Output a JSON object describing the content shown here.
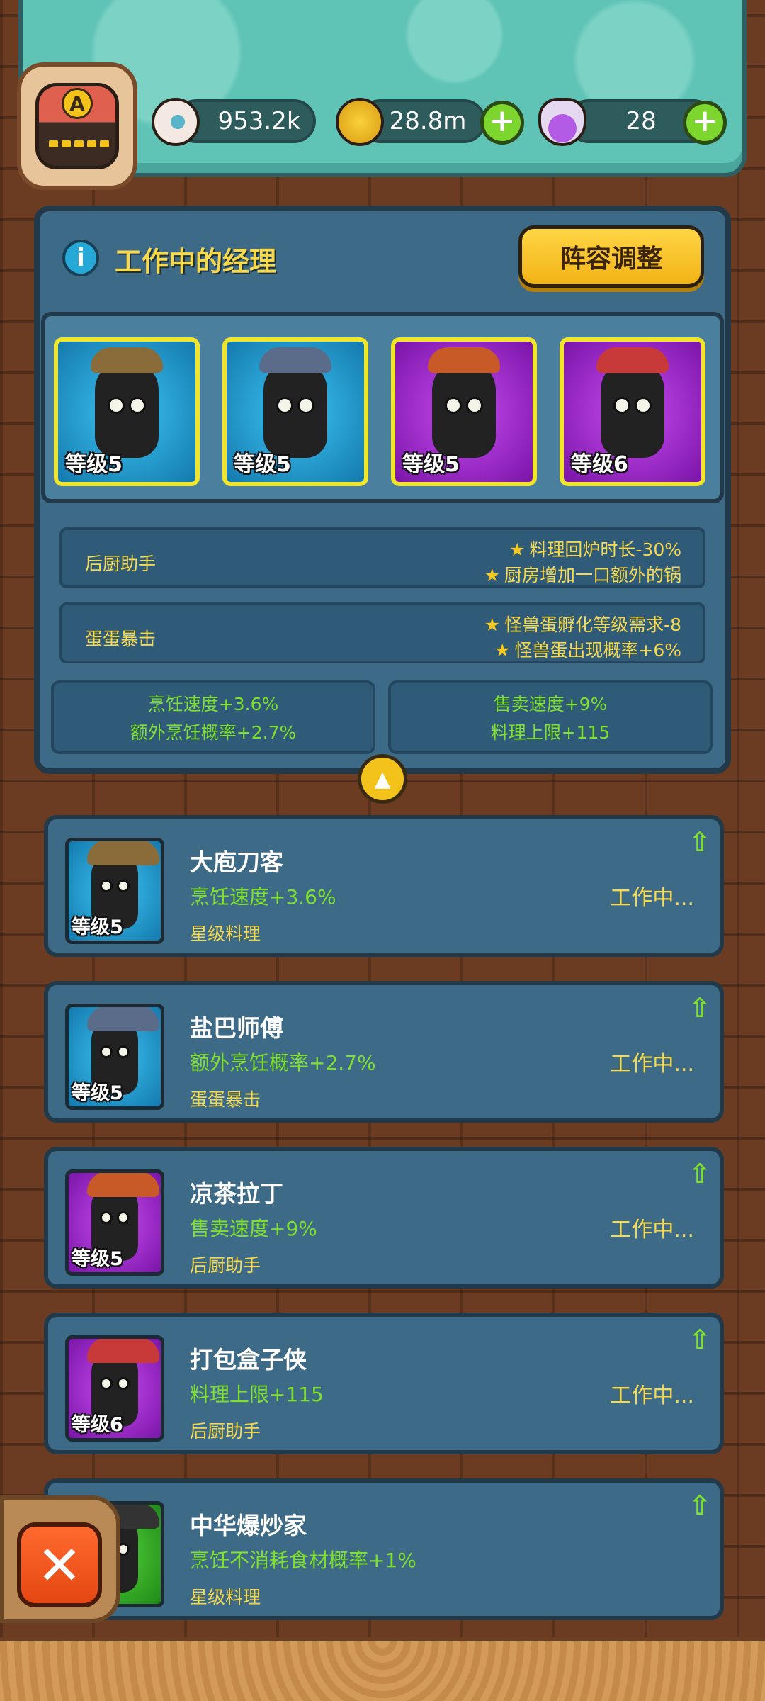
{
  "player": {
    "rank_letter": "A"
  },
  "resources": {
    "eyes": {
      "icon": "eyeball-icon",
      "value": "953.2k"
    },
    "coins": {
      "icon": "gold-coin-icon",
      "value": "28.8m",
      "plus": "+"
    },
    "potions": {
      "icon": "potion-flask-icon",
      "value": "28",
      "plus": "+"
    }
  },
  "board": {
    "info_icon": "i",
    "title": "工作中的经理",
    "lineup_button": "阵容调整",
    "managers": [
      {
        "level": "等级5",
        "rarity": "blue",
        "hat_color": "#8a6b3a"
      },
      {
        "level": "等级5",
        "rarity": "blue",
        "hat_color": "#5a6c8a"
      },
      {
        "level": "等级5",
        "rarity": "purple",
        "hat_color": "#c85a28"
      },
      {
        "level": "等级6",
        "rarity": "purple",
        "hat_color": "#c83a3a"
      }
    ],
    "bonuses": [
      {
        "name": "后厨助手",
        "lines": [
          "料理回炉时长-30%",
          "厨房增加一口额外的锅"
        ]
      },
      {
        "name": "蛋蛋暴击",
        "lines": [
          "怪兽蛋孵化等级需求-8",
          "怪兽蛋出现概率+6%"
        ]
      }
    ],
    "stats_left": [
      "烹饪速度+3.6%",
      "额外烹饪概率+2.7%"
    ],
    "stats_right": [
      "售卖速度+9%",
      "料理上限+115"
    ],
    "collapse_icon": "▲"
  },
  "list": [
    {
      "name": "大庖刀客",
      "bonus": "烹饪速度+3.6%",
      "skill": "星级料理",
      "status": "工作中...",
      "level": "等级5",
      "rarity": "blue",
      "hat_color": "#8a6b3a"
    },
    {
      "name": "盐巴师傅",
      "bonus": "额外烹饪概率+2.7%",
      "skill": "蛋蛋暴击",
      "status": "工作中...",
      "level": "等级5",
      "rarity": "blue",
      "hat_color": "#5a6c8a"
    },
    {
      "name": "凉茶拉丁",
      "bonus": "售卖速度+9%",
      "skill": "后厨助手",
      "status": "工作中...",
      "level": "等级5",
      "rarity": "purple",
      "hat_color": "#c85a28"
    },
    {
      "name": "打包盒子侠",
      "bonus": "料理上限+115",
      "skill": "后厨助手",
      "status": "工作中...",
      "level": "等级6",
      "rarity": "purple",
      "hat_color": "#c83a3a"
    },
    {
      "name": "中华爆炒家",
      "bonus": "烹饪不消耗食材概率+1%",
      "skill": "星级料理",
      "status": "",
      "level": "",
      "rarity": "green",
      "hat_color": "#333333"
    }
  ],
  "upgrade_icon": "⇧",
  "close_icon": "✕",
  "colors": {
    "accent_yellow": "#f7d94d",
    "bonus_green": "#7fe02e",
    "panel_blue": "#3d6a86"
  }
}
